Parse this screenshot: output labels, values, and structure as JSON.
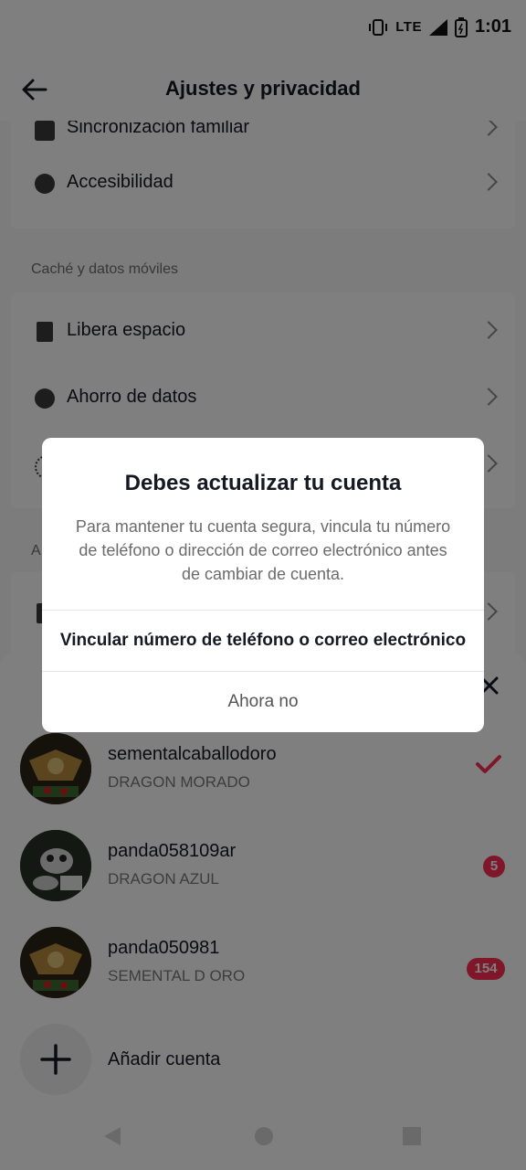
{
  "status": {
    "network": "LTE",
    "time": "1:01"
  },
  "header": {
    "title": "Ajustes y privacidad"
  },
  "settings": {
    "partial_item": "Sincronización familiar",
    "accessibility": "Accesibilidad",
    "cache_section": "Caché y datos móviles",
    "free_space": "Libera espacio",
    "data_saver": "Ahorro de datos",
    "partial_section_initial": "A"
  },
  "accounts": [
    {
      "username": "sementalcaballodoro",
      "display_name": "DRAGON MORADO",
      "selected": true
    },
    {
      "username": "panda058109ar",
      "display_name": "DRAGON AZUL",
      "badge": "5"
    },
    {
      "username": "panda050981",
      "display_name": "SEMENTAL D ORO",
      "badge": "154"
    }
  ],
  "add_account": "Añadir cuenta",
  "modal": {
    "title": "Debes actualizar tu cuenta",
    "message": "Para mantener tu cuenta segura, vincula tu número de teléfono o dirección de correo electrónico antes de cambiar de cuenta.",
    "primary": "Vincular número de teléfono o correo electrónico",
    "secondary": "Ahora no"
  },
  "colors": {
    "accent": "#fe2c55",
    "overlay": "rgba(0,0,0,0.5)"
  }
}
